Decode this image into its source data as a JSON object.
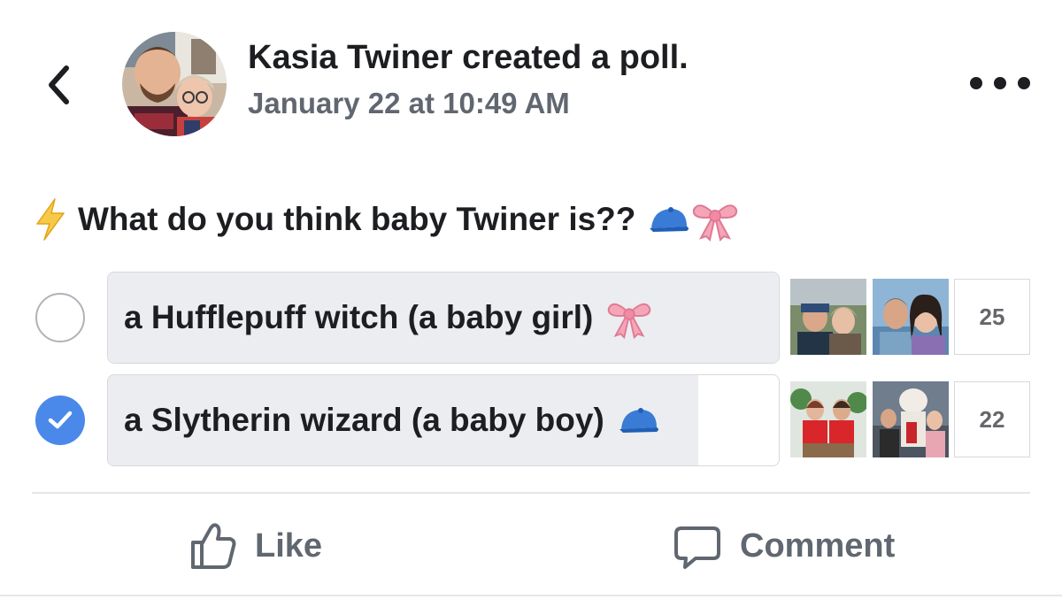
{
  "post": {
    "author_name": "Kasia Twiner",
    "action_text": "created a poll.",
    "timestamp": "January 22 at 10:49 AM"
  },
  "icons": {
    "back": "chevron-left-icon",
    "more": "more-options-icon",
    "question_prefix": "lightning-icon",
    "boy": "blue-cap-icon",
    "girl": "pink-bow-icon",
    "selected": "check-icon",
    "like": "thumbs-up-icon",
    "comment": "comment-bubble-icon"
  },
  "poll": {
    "question": "What do you think baby Twiner is??",
    "options": [
      {
        "label": "a Hufflepuff witch (a baby girl)",
        "votes": "25",
        "selected": false,
        "vote_share": 1.0
      },
      {
        "label": "a Slytherin wizard (a baby boy)",
        "votes": "22",
        "selected": true,
        "vote_share": 0.88
      }
    ]
  },
  "actions": {
    "like_label": "Like",
    "comment_label": "Comment"
  },
  "colors": {
    "accent_blue": "#4a89ea",
    "text_primary": "#1c1e21",
    "text_secondary": "#616770",
    "option_fill": "#ebedf0",
    "border": "#d6d9dd"
  }
}
